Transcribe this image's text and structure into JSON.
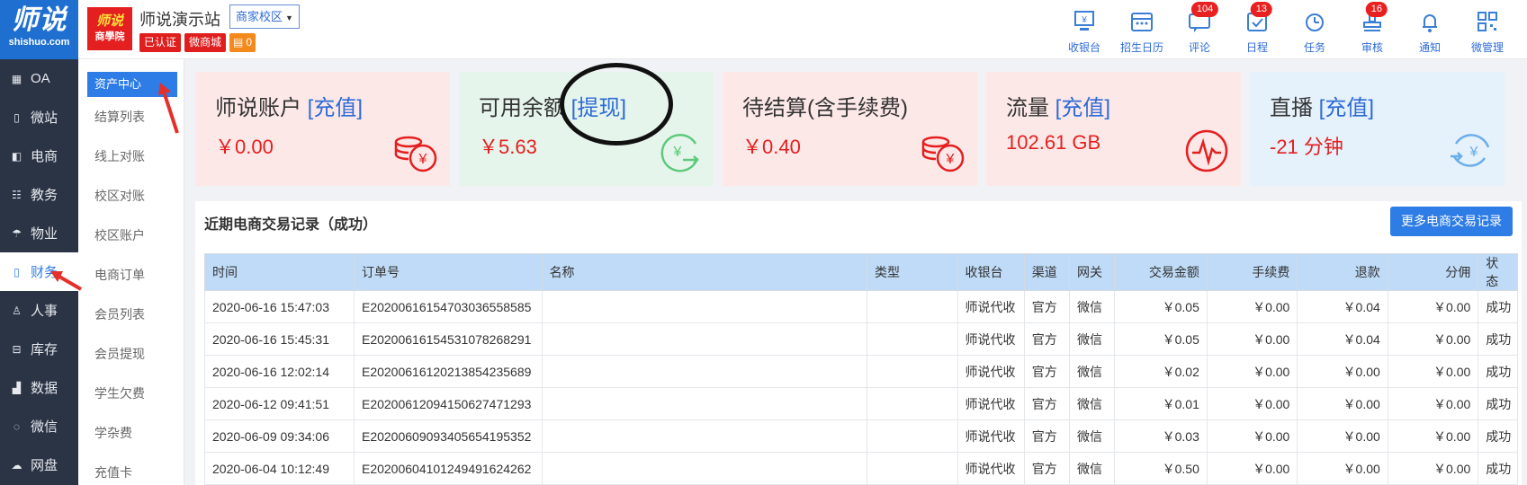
{
  "logo": {
    "title": "师说",
    "subtitle": "shishuo.com"
  },
  "nav": [
    {
      "label": "OA",
      "icon": "calendar-icon"
    },
    {
      "label": "微站",
      "icon": "tablet-icon"
    },
    {
      "label": "电商",
      "icon": "bag-icon"
    },
    {
      "label": "教务",
      "icon": "list-icon"
    },
    {
      "label": "物业",
      "icon": "umbrella-icon"
    },
    {
      "label": "财务",
      "icon": "book-icon",
      "active": true
    },
    {
      "label": "人事",
      "icon": "user-icon"
    },
    {
      "label": "库存",
      "icon": "box-icon"
    },
    {
      "label": "数据",
      "icon": "bar-chart-icon"
    },
    {
      "label": "微信",
      "icon": "chat-icon"
    },
    {
      "label": "网盘",
      "icon": "cloud-icon"
    }
  ],
  "submenu": [
    {
      "label": "资产中心",
      "active": true
    },
    {
      "label": "结算列表"
    },
    {
      "label": "线上对账"
    },
    {
      "label": "校区对账"
    },
    {
      "label": "校区账户"
    },
    {
      "label": "电商订单"
    },
    {
      "label": "会员列表"
    },
    {
      "label": "会员提现"
    },
    {
      "label": "学生欠费"
    },
    {
      "label": "学杂费"
    },
    {
      "label": "充值卡"
    }
  ],
  "header": {
    "brand_top": "师说",
    "brand_bottom": "商學院",
    "site_title": "师说演示站",
    "campus": "商家校区",
    "tags": {
      "verified": "已认证",
      "shop": "微商城",
      "coins": "0"
    }
  },
  "tools": [
    {
      "label": "收银台",
      "icon": "cashier-icon",
      "badge": ""
    },
    {
      "label": "招生日历",
      "icon": "calendar-icon",
      "badge": ""
    },
    {
      "label": "评论",
      "icon": "comment-icon",
      "badge": "104"
    },
    {
      "label": "日程",
      "icon": "schedule-icon",
      "badge": "13"
    },
    {
      "label": "任务",
      "icon": "task-icon",
      "badge": ""
    },
    {
      "label": "审核",
      "icon": "stamp-icon",
      "badge": "16"
    },
    {
      "label": "通知",
      "icon": "bell-icon",
      "badge": ""
    },
    {
      "label": "微管理",
      "icon": "qrcode-icon",
      "badge": ""
    }
  ],
  "cards": [
    {
      "title": "师说账户",
      "action": "[充值]",
      "value": "￥0.00",
      "icon": "coins-icon",
      "bg": "#fde8e8",
      "color": "#e41f1f"
    },
    {
      "title": "可用余额",
      "action": "[提现]",
      "value": "￥5.63",
      "icon": "withdraw-icon",
      "bg": "#e6f5ec",
      "color": "#5cc97b"
    },
    {
      "title": "待结算(含手续费)",
      "action": "",
      "value": "￥0.40",
      "icon": "coins-icon",
      "bg": "#fde8e8",
      "color": "#e41f1f"
    },
    {
      "title": "流量",
      "action": "[充值]",
      "value": "102.61 GB",
      "icon": "pulse-icon",
      "bg": "#fde8e8",
      "color": "#e41f1f"
    },
    {
      "title": "直播",
      "action": "[充值]",
      "value": "-21 分钟",
      "icon": "transfer-icon",
      "bg": "#e5f1fb",
      "color": "#6aaee8"
    }
  ],
  "records": {
    "title": "近期电商交易记录（成功）",
    "more_button": "更多电商交易记录",
    "columns": [
      "时间",
      "订单号",
      "名称",
      "类型",
      "收银台",
      "渠道",
      "网关",
      "交易金额",
      "手续费",
      "退款",
      "分佣",
      "状态"
    ],
    "rows": [
      [
        "2020-06-16 15:47:03",
        "E20200616154703036558585",
        "",
        "",
        "师说代收",
        "官方",
        "微信",
        "￥0.05",
        "￥0.00",
        "￥0.04",
        "￥0.00",
        "成功"
      ],
      [
        "2020-06-16 15:45:31",
        "E20200616154531078268291",
        "",
        "",
        "师说代收",
        "官方",
        "微信",
        "￥0.05",
        "￥0.00",
        "￥0.04",
        "￥0.00",
        "成功"
      ],
      [
        "2020-06-16 12:02:14",
        "E20200616120213854235689",
        "",
        "",
        "师说代收",
        "官方",
        "微信",
        "￥0.02",
        "￥0.00",
        "￥0.00",
        "￥0.00",
        "成功"
      ],
      [
        "2020-06-12 09:41:51",
        "E20200612094150627471293",
        "",
        "",
        "师说代收",
        "官方",
        "微信",
        "￥0.01",
        "￥0.00",
        "￥0.00",
        "￥0.00",
        "成功"
      ],
      [
        "2020-06-09 09:34:06",
        "E20200609093405654195352",
        "",
        "",
        "师说代收",
        "官方",
        "微信",
        "￥0.03",
        "￥0.00",
        "￥0.00",
        "￥0.00",
        "成功"
      ],
      [
        "2020-06-04 10:12:49",
        "E20200604101249491624262",
        "",
        "",
        "师说代收",
        "官方",
        "微信",
        "￥0.50",
        "￥0.00",
        "￥0.00",
        "￥0.00",
        "成功"
      ]
    ]
  }
}
